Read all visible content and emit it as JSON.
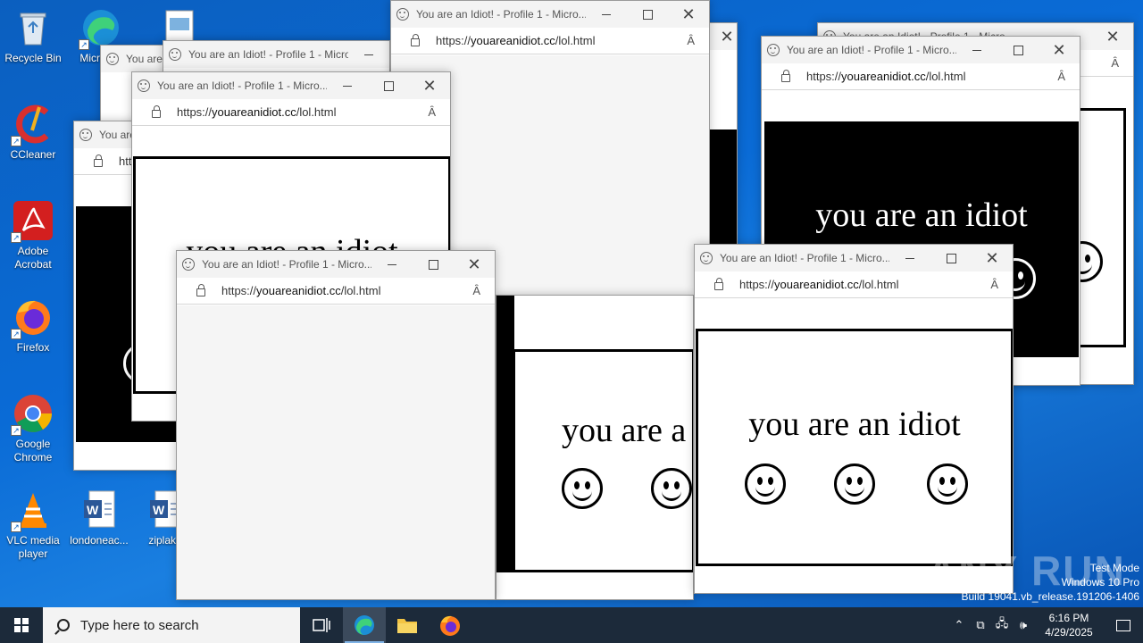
{
  "desktop_icons": [
    {
      "label": "Recycle Bin"
    },
    {
      "label": "Micro Ed"
    },
    {
      "label": "CCleaner"
    },
    {
      "label": "Adobe Acrobat"
    },
    {
      "label": "Firefox"
    },
    {
      "label": "Google Chrome"
    },
    {
      "label": "VLC media player"
    },
    {
      "label": "londoneac..."
    },
    {
      "label": "ziplake"
    }
  ],
  "browser": {
    "title": "You are an Idiot! - Profile 1 - Micro...",
    "title_short": "You are",
    "url_prefix": "https://",
    "url_domain": "youareanidiot.cc",
    "url_path": "/lol.html",
    "read_aloud": "Ȃ"
  },
  "page": {
    "text": "you are an idiot",
    "text_partial": "you are a",
    "text_cut": "you are an idiot"
  },
  "taskbar": {
    "search_placeholder": "Type here to search",
    "time": "6:16 PM",
    "date": "4/29/2025"
  },
  "watermark": {
    "brand": "ANY RUN",
    "line1": "Test Mode",
    "line2": "Windows 10 Pro",
    "line3": "Build 19041.vb_release.191206-1406"
  },
  "colors": {
    "desktop": "#0a6bd6",
    "taskbar": "#1c2a3a"
  }
}
